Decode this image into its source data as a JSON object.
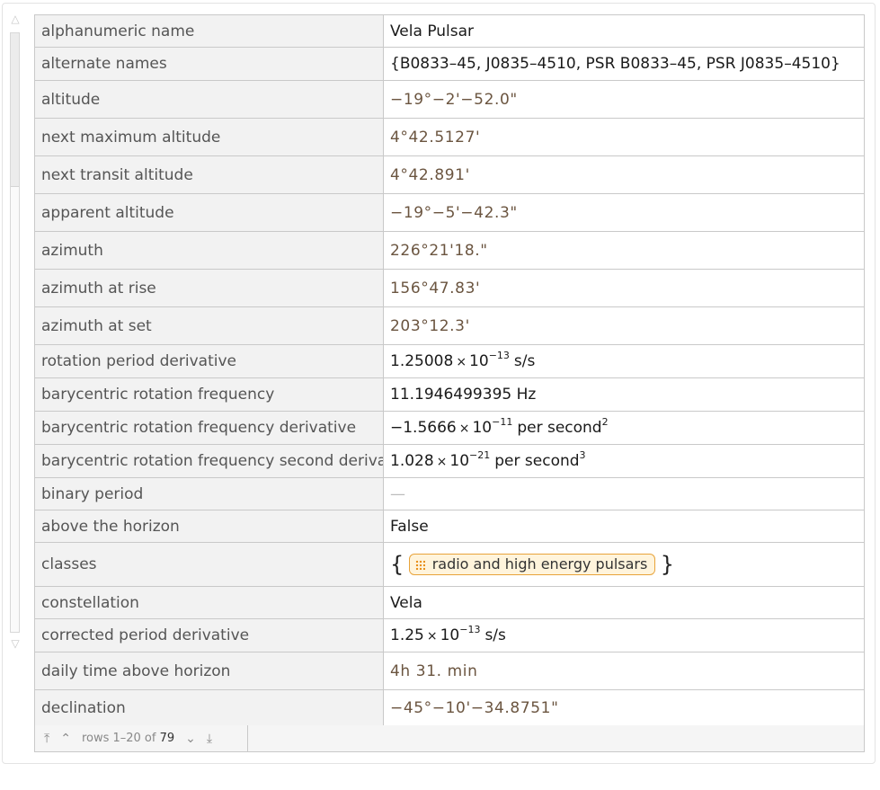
{
  "rows": [
    {
      "key": "alphanumeric name",
      "value": "Vela Pulsar",
      "style": "plain"
    },
    {
      "key": "alternate names",
      "value": "{B0833–45, J0835–4510, PSR B0833–45, PSR J0835–4510}",
      "style": "plain"
    },
    {
      "key": "altitude",
      "value": "−19°−2'−52.0\"",
      "style": "num"
    },
    {
      "key": "next maximum altitude",
      "value": "4°42.5127'",
      "style": "num"
    },
    {
      "key": "next transit altitude",
      "value": "4°42.891'",
      "style": "num"
    },
    {
      "key": "apparent altitude",
      "value": "−19°−5'−42.3\"",
      "style": "num"
    },
    {
      "key": "azimuth",
      "value": "226°21'18.\"",
      "style": "num"
    },
    {
      "key": "azimuth at rise",
      "value": "156°47.83'",
      "style": "num"
    },
    {
      "key": "azimuth at set",
      "value": "203°12.3'",
      "style": "num"
    },
    {
      "key": "rotation period derivative",
      "mantissa": "1.25008",
      "times": "×",
      "base": "10",
      "exp": "−13",
      "unit": "s/s",
      "style": "sci"
    },
    {
      "key": "barycentric rotation frequency",
      "value": "11.1946499395 Hz",
      "style": "plain"
    },
    {
      "key": "barycentric rotation frequency derivative",
      "mantissa": "−1.5666",
      "times": "×",
      "base": "10",
      "exp": "−11",
      "unit": "per second",
      "unit_exp": "2",
      "style": "sci"
    },
    {
      "key": "barycentric rotation frequency second derivative",
      "mantissa": "1.028",
      "times": "×",
      "base": "10",
      "exp": "−21",
      "unit": "per second",
      "unit_exp": "3",
      "style": "sci"
    },
    {
      "key": "binary period",
      "value": "—",
      "style": "dash"
    },
    {
      "key": "above the horizon",
      "value": "False",
      "style": "plain"
    },
    {
      "key": "classes",
      "open": "{",
      "chip": "radio and high energy pulsars",
      "chip_icon": "entity-class-icon",
      "close": "}",
      "style": "chip"
    },
    {
      "key": "constellation",
      "value": "Vela",
      "style": "plain"
    },
    {
      "key": "corrected period derivative",
      "mantissa": "1.25",
      "times": "×",
      "base": "10",
      "exp": "−13",
      "unit": "s/s",
      "style": "sci"
    },
    {
      "key": "daily time above horizon",
      "value": "4h 31. min",
      "style": "num"
    },
    {
      "key": "declination",
      "value": "−45°−10'−34.8751\"",
      "style": "num"
    }
  ],
  "row_heights": [
    36,
    37,
    42,
    42,
    42,
    42,
    42,
    42,
    42,
    37,
    37,
    37,
    37,
    36,
    36,
    49,
    36,
    37,
    42,
    41
  ],
  "pager": {
    "first": "⤒",
    "prev": "⌃",
    "rows_label": "rows 1–20 of",
    "total": "79",
    "next": "⌄",
    "last": "⤓"
  }
}
